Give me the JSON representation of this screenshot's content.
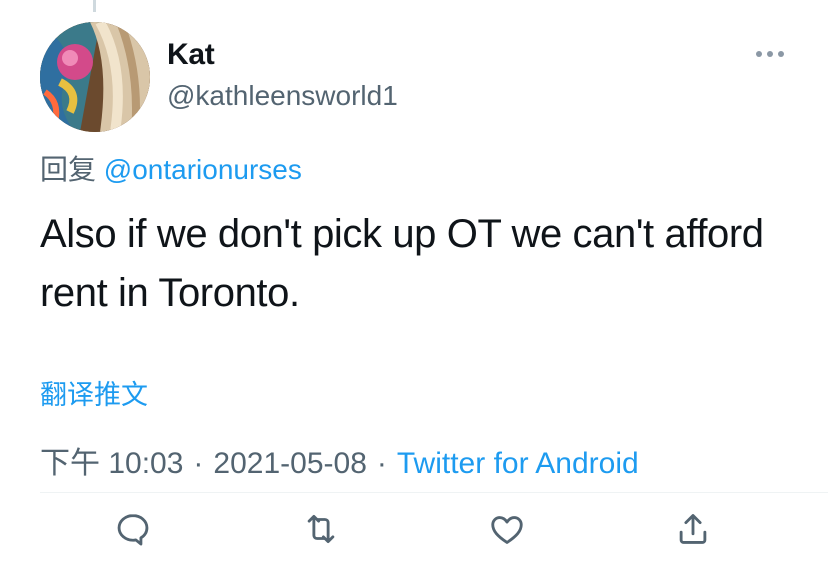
{
  "tweet": {
    "author_name": "Kat",
    "author_handle": "@kathleensworld1",
    "reply_prefix": "回复",
    "reply_to": "@ontarionurses",
    "text": "Also if we don't pick up OT we can't afford rent in Toronto.",
    "translate_label": "翻译推文",
    "time": "下午 10:03",
    "separator": "·",
    "date": "2021-05-08",
    "source": "Twitter for Android"
  },
  "actions": {
    "reply_icon": "reply-icon",
    "retweet_icon": "retweet-icon",
    "like_icon": "like-icon",
    "share_icon": "share-icon"
  },
  "colors": {
    "text": "#0f1419",
    "secondary": "#536471",
    "link": "#1d9bf0",
    "icon": "#536471"
  }
}
